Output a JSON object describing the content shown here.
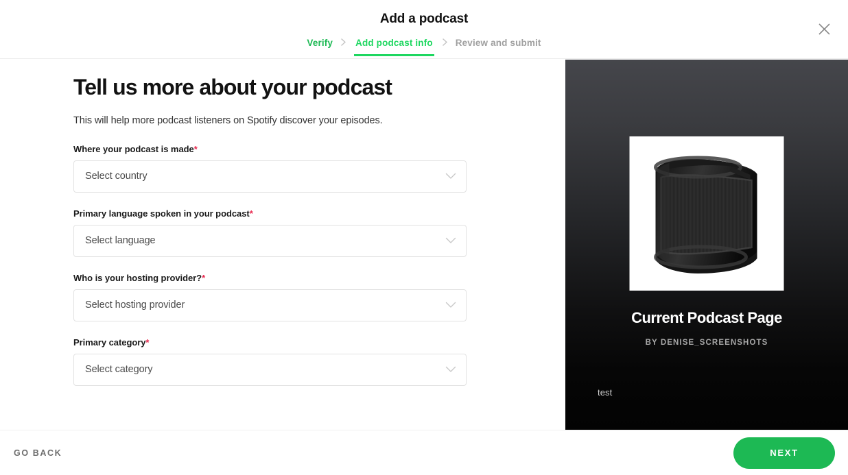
{
  "header": {
    "title": "Add a podcast",
    "close_icon": "close-icon",
    "separator_icon": "chevron-right-icon",
    "steps": [
      {
        "label": "Verify",
        "state": "done"
      },
      {
        "label": "Add podcast info",
        "state": "active"
      },
      {
        "label": "Review and submit",
        "state": "upcoming"
      }
    ]
  },
  "main": {
    "heading": "Tell us more about your podcast",
    "subheading": "This will help more podcast listeners on Spotify discover your episodes.",
    "required_marker": "*",
    "chevron_icon": "chevron-down-icon",
    "fields": [
      {
        "label": "Where your podcast is made",
        "required": true,
        "value": "Select country",
        "name": "country-select"
      },
      {
        "label": "Primary language spoken in your podcast",
        "required": true,
        "value": "Select language",
        "name": "language-select"
      },
      {
        "label": "Who is your hosting provider?",
        "required": true,
        "value": "Select hosting provider",
        "name": "hosting-provider-select"
      },
      {
        "label": "Primary category",
        "required": true,
        "value": "Select category",
        "name": "category-select"
      }
    ]
  },
  "preview": {
    "artwork_icon": "microphone-pop-filter-image",
    "title": "Current Podcast Page",
    "author": "BY DENISE_SCREENSHOTS",
    "description": "test"
  },
  "footer": {
    "back_label": "GO BACK",
    "next_label": "NEXT"
  },
  "colors": {
    "accent_green": "#1ed760",
    "button_green": "#1db954",
    "required_red": "#e8284e",
    "muted_grey": "#a0a0a0",
    "panel_dark": "#030303"
  }
}
